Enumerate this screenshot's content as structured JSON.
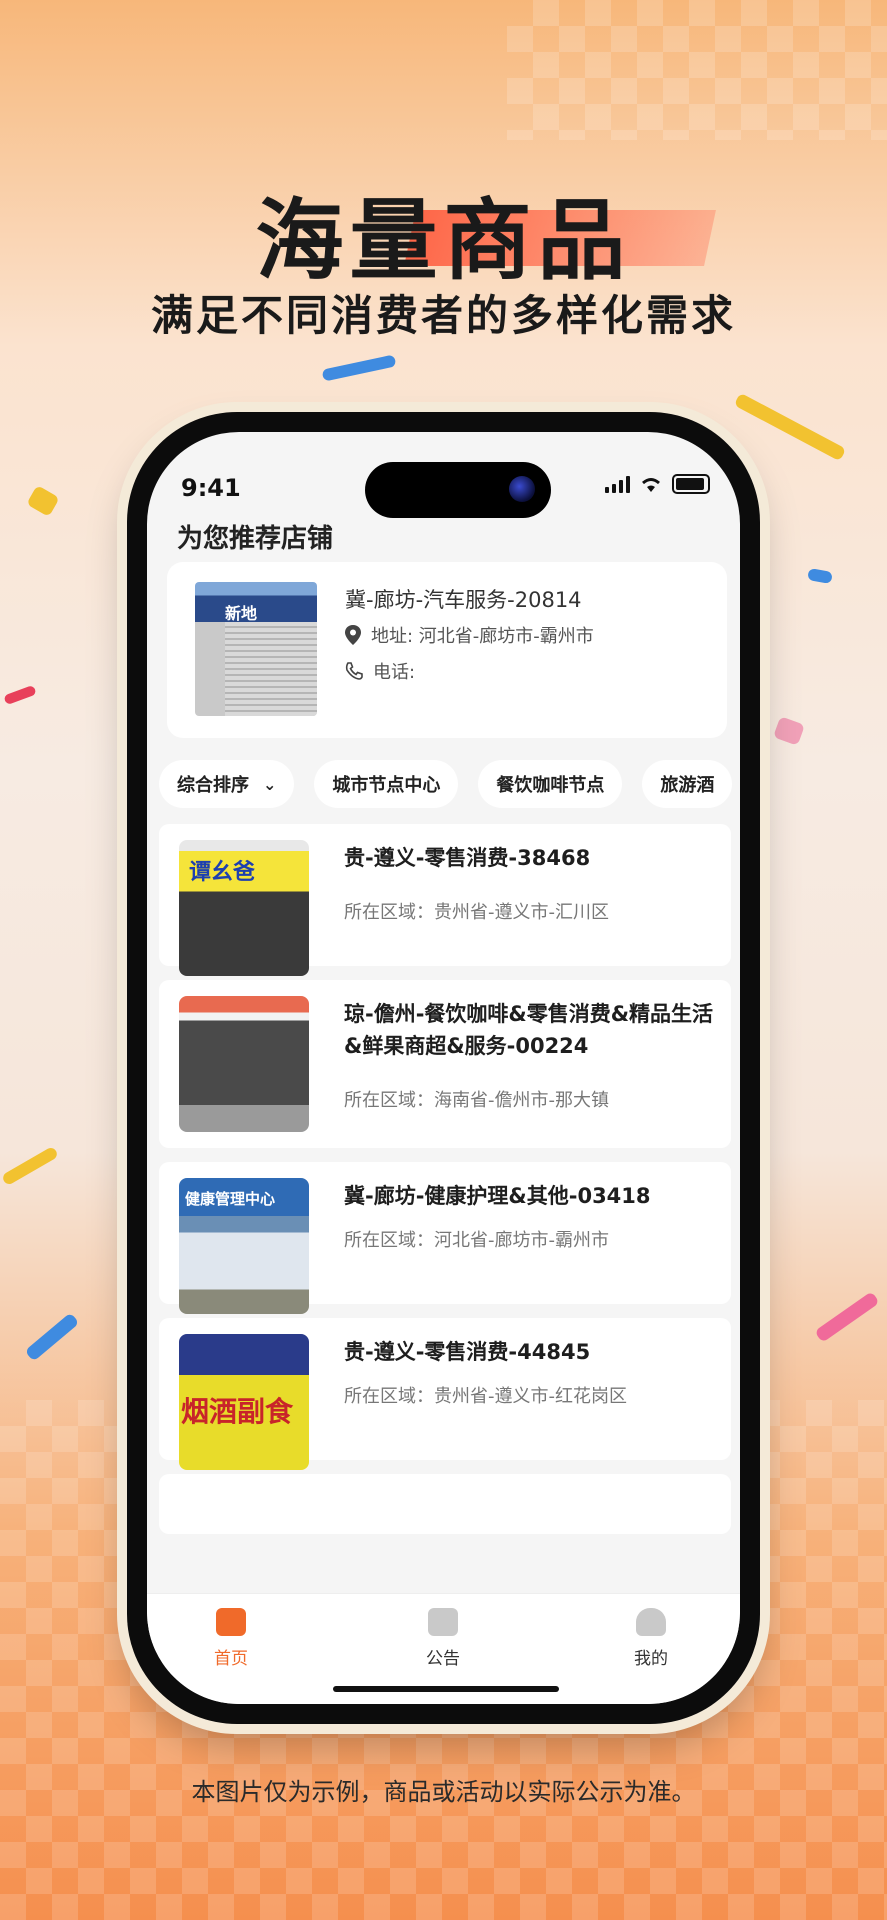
{
  "hero": {
    "title": "海量商品",
    "subtitle": "满足不同消费者的多样化需求"
  },
  "footnote": "本图片仅为示例，商品或活动以实际公示为准。",
  "status_bar": {
    "time": "9:41"
  },
  "section_title": "为您推荐店铺",
  "featured": {
    "name": "冀-廊坊-汽车服务-20814",
    "address": "地址: 河北省-廊坊市-霸州市",
    "phone": "电话:",
    "photo_sign": "新地"
  },
  "filters": [
    {
      "label": "综合排序"
    },
    {
      "label": "城市节点中心"
    },
    {
      "label": "餐饮咖啡节点"
    },
    {
      "label": "旅游酒"
    }
  ],
  "stores": [
    {
      "title": "贵-遵义-零售消费-38468",
      "area": "所在区域：贵州省-遵义市-汇川区",
      "photo_sign": "谭幺爸"
    },
    {
      "title": "琼-儋州-餐饮咖啡&零售消费&精品生活&鲜果商超&服务-00224",
      "area": "所在区域：海南省-儋州市-那大镇",
      "photo_sign": ""
    },
    {
      "title": "冀-廊坊-健康护理&其他-03418",
      "area": "所在区域：河北省-廊坊市-霸州市",
      "photo_sign": "健康管理中心"
    },
    {
      "title": "贵-遵义-零售消费-44845",
      "area": "所在区域：贵州省-遵义市-红花岗区",
      "photo_sign": "烟酒副食"
    }
  ],
  "tabs": [
    {
      "label": "首页",
      "icon": "home-icon",
      "active": true
    },
    {
      "label": "公告",
      "icon": "notice-icon",
      "active": false
    },
    {
      "label": "我的",
      "icon": "profile-icon",
      "active": false
    }
  ],
  "colors": {
    "accent": "#f06a2a",
    "background_top": "#f7b77a",
    "background_bottom": "#f58f4e"
  }
}
